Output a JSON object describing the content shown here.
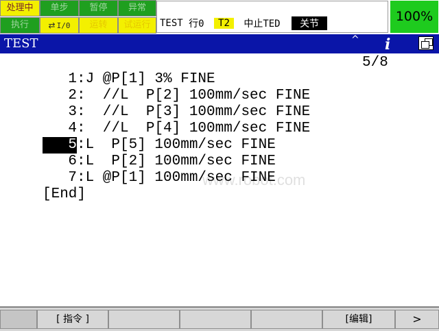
{
  "status": {
    "busy": "处理中",
    "step": "单步",
    "hold": "暂停",
    "fault": "异常",
    "run": "执行",
    "io_arrows": "⇄",
    "io": "I/0",
    "moving": "运转",
    "test_mode": "试运行"
  },
  "message": {
    "program": "TEST",
    "line": "行0",
    "mode": "T2",
    "state": "中止TED",
    "coord": "关节"
  },
  "override": "100%",
  "titlebar": {
    "title": "TEST",
    "caret": "^",
    "info": "i"
  },
  "program": {
    "position": "5/8",
    "lines": [
      {
        "num": "1",
        "text": ":J @P[1] 3% FINE"
      },
      {
        "num": "2",
        "text": ":  //L  P[2] 100mm/sec FINE"
      },
      {
        "num": "3",
        "text": ":  //L  P[3] 100mm/sec FINE"
      },
      {
        "num": "4",
        "text": ":  //L  P[4] 100mm/sec FINE"
      },
      {
        "num": "5",
        "text": ":L  P[5] 100mm/sec FINE"
      },
      {
        "num": "6",
        "text": ":L  P[2] 100mm/sec FINE"
      },
      {
        "num": "7",
        "text": ":L @P[1] 100mm/sec FINE"
      }
    ],
    "end": "[End]",
    "watermark": "www.robot.com"
  },
  "fkeys": {
    "f2": "[ 指令 ]",
    "f6": "[编辑]",
    "next": ">"
  }
}
